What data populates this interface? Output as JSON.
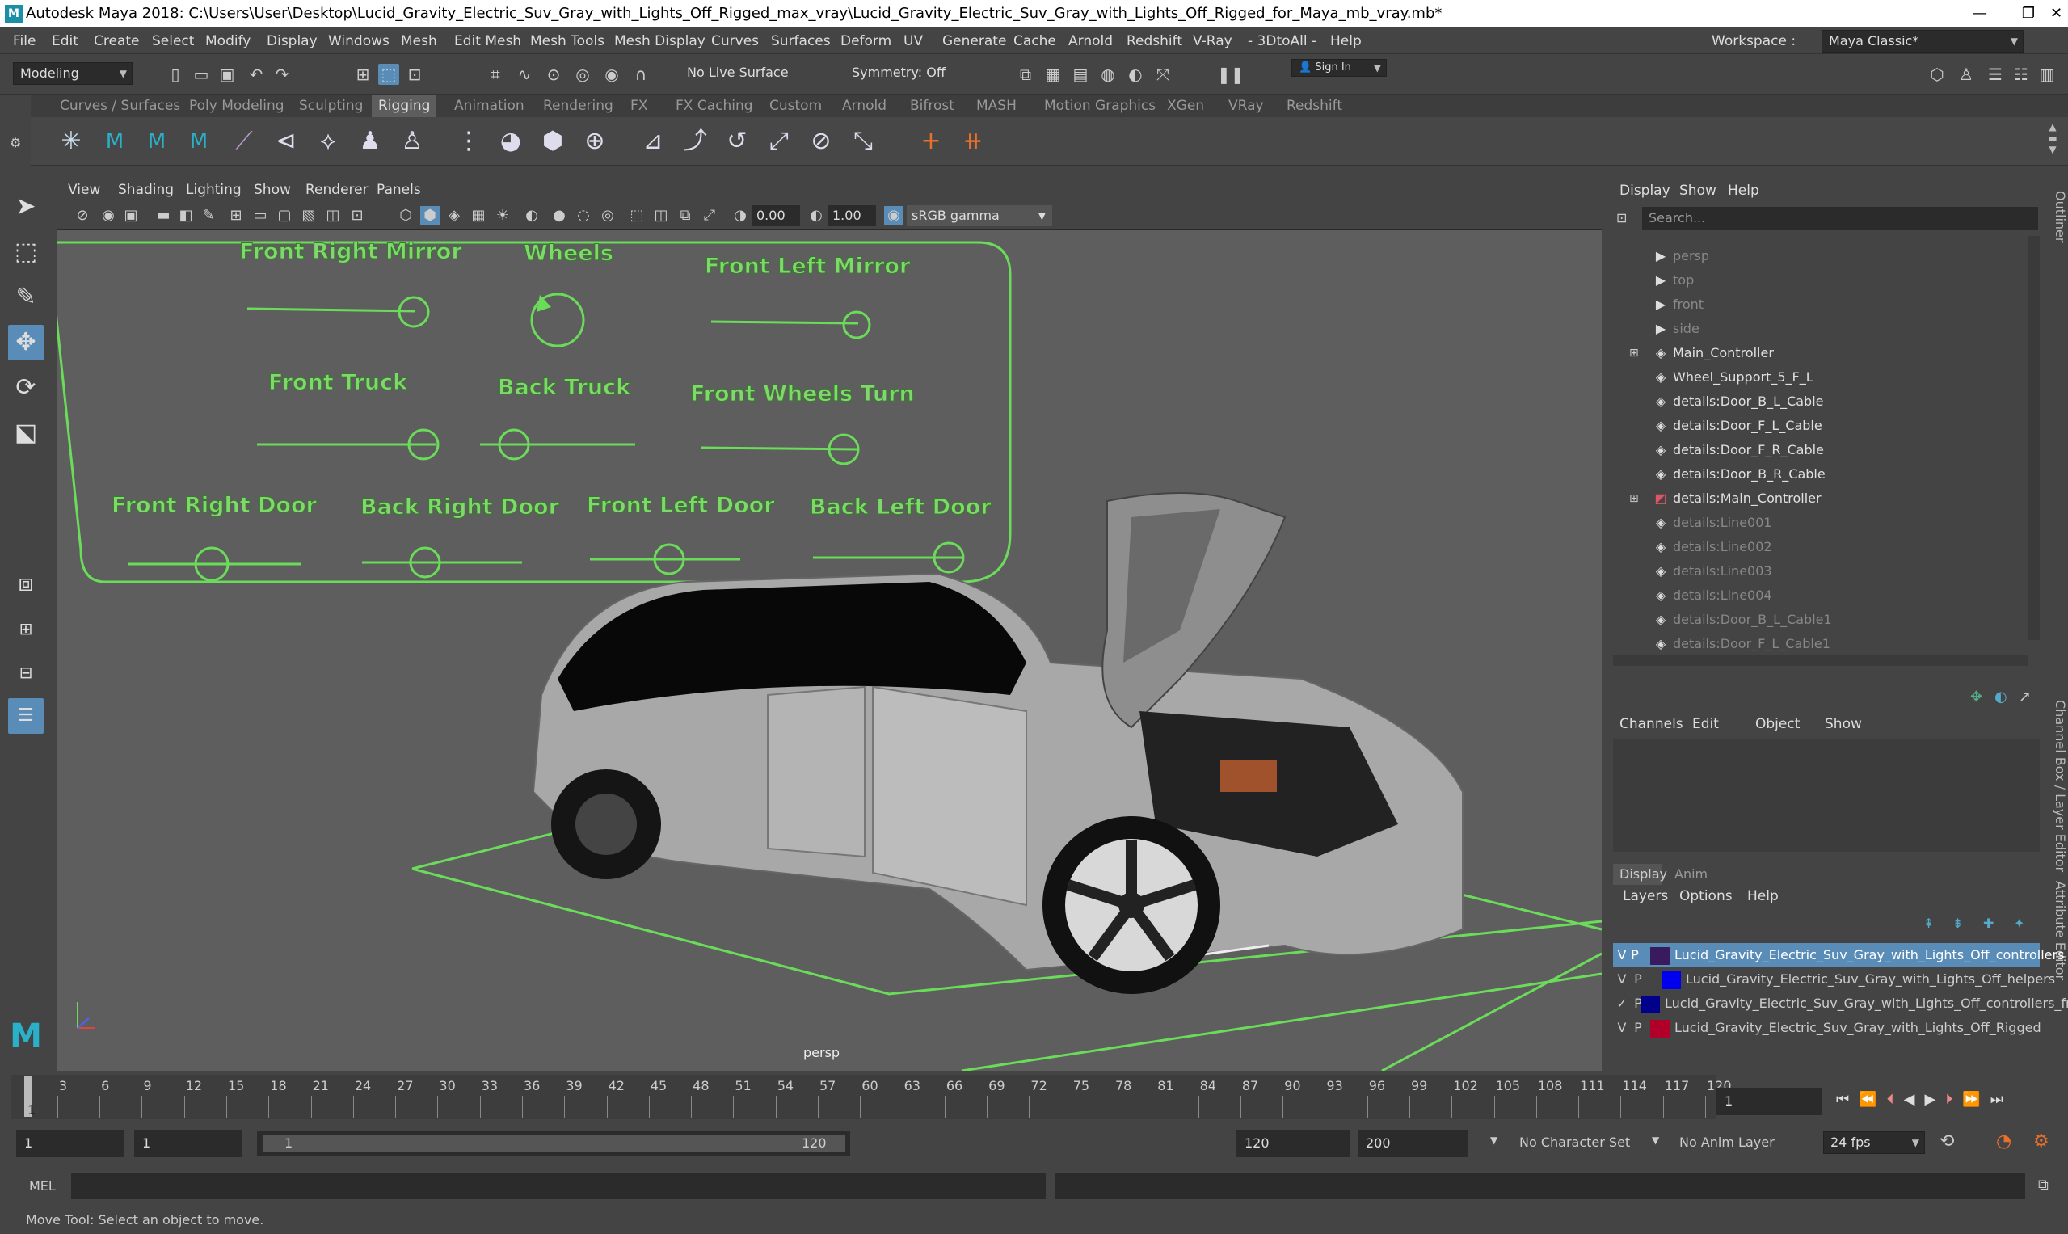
{
  "window": {
    "title": "Autodesk Maya 2018: C:\\Users\\User\\Desktop\\Lucid_Gravity_Electric_Suv_Gray_with_Lights_Off_Rigged_max_vray\\Lucid_Gravity_Electric_Suv_Gray_with_Lights_Off_Rigged_for_Maya_mb_vray.mb*",
    "minimize": "—",
    "maximize": "❐",
    "close": "✕"
  },
  "menu": [
    "File",
    "Edit",
    "Create",
    "Select",
    "Modify",
    "Display",
    "Windows",
    "Mesh",
    "Edit Mesh",
    "Mesh Tools",
    "Mesh Display",
    "Curves",
    "Surfaces",
    "Deform",
    "UV",
    "Generate",
    "Cache",
    "Arnold",
    "Redshift",
    "V-Ray",
    "- 3DtoAll -",
    "Help"
  ],
  "workspace": {
    "label": "Workspace :",
    "value": "Maya Classic*"
  },
  "status": {
    "mode": "Modeling",
    "live_surface": "No Live Surface",
    "symmetry": "Symmetry: Off",
    "sign_in": "Sign In"
  },
  "shelf_tabs": [
    "Curves / Surfaces",
    "Poly Modeling",
    "Sculpting",
    "Rigging",
    "Animation",
    "Rendering",
    "FX",
    "FX Caching",
    "Custom",
    "Arnold",
    "Bifrost",
    "MASH",
    "Motion Graphics",
    "XGen",
    "VRay",
    "Redshift"
  ],
  "shelf_active": "Rigging",
  "viewport": {
    "menu": [
      "View",
      "Shading",
      "Lighting",
      "Show",
      "Renderer",
      "Panels"
    ],
    "exposure": "0.00",
    "gamma": "1.00",
    "color_space": "sRGB gamma",
    "camera_label": "persp"
  },
  "controls": {
    "front_right_mirror": "Front Right Mirror",
    "wheels": "Wheels",
    "front_left_mirror": "Front Left Mirror",
    "front_truck": "Front Truck",
    "back_truck": "Back Truck",
    "front_wheels_turn": "Front Wheels Turn",
    "front_right_door": "Front Right Door",
    "back_right_door": "Back Right Door",
    "front_left_door": "Front Left Door",
    "back_left_door": "Back Left Door"
  },
  "outliner": {
    "menu": [
      "Display",
      "Show",
      "Help"
    ],
    "search_placeholder": "Search...",
    "items": [
      {
        "label": "persp",
        "dim": true,
        "icon": "camera-icon"
      },
      {
        "label": "top",
        "dim": true,
        "icon": "camera-icon"
      },
      {
        "label": "front",
        "dim": true,
        "icon": "camera-icon"
      },
      {
        "label": "side",
        "dim": true,
        "icon": "camera-icon"
      },
      {
        "label": "Main_Controller",
        "dim": false,
        "icon": "transform-icon",
        "expand": true
      },
      {
        "label": "Wheel_Support_5_F_L",
        "dim": false,
        "icon": "transform-icon"
      },
      {
        "label": "details:Door_B_L_Cable",
        "dim": false,
        "icon": "transform-icon"
      },
      {
        "label": "details:Door_F_L_Cable",
        "dim": false,
        "icon": "transform-icon"
      },
      {
        "label": "details:Door_F_R_Cable",
        "dim": false,
        "icon": "transform-icon"
      },
      {
        "label": "details:Door_B_R_Cable",
        "dim": false,
        "icon": "transform-icon"
      },
      {
        "label": "details:Main_Controller",
        "dim": false,
        "icon": "controller-icon",
        "expand": true
      },
      {
        "label": "details:Line001",
        "dim": true,
        "icon": "transform-icon"
      },
      {
        "label": "details:Line002",
        "dim": true,
        "icon": "transform-icon"
      },
      {
        "label": "details:Line003",
        "dim": true,
        "icon": "transform-icon"
      },
      {
        "label": "details:Line004",
        "dim": true,
        "icon": "transform-icon"
      },
      {
        "label": "details:Door_B_L_Cable1",
        "dim": true,
        "icon": "transform-icon"
      },
      {
        "label": "details:Door_F_L_Cable1",
        "dim": true,
        "icon": "transform-icon"
      }
    ]
  },
  "channel_box": {
    "menu": [
      "Channels",
      "Edit",
      "Object",
      "Show"
    ],
    "side_tab": "Channel Box / Layer Editor",
    "attr_tab": "Attribute Editor",
    "outliner_tab": "Outliner"
  },
  "layer_editor": {
    "tabs": [
      "Display",
      "Anim"
    ],
    "menu": [
      "Layers",
      "Options",
      "Help"
    ],
    "layers": [
      {
        "v": "V",
        "p": "P",
        "name": "Lucid_Gravity_Electric_Suv_Gray_with_Lights_Off_controllers",
        "color": "#3a1a5e",
        "selected": true
      },
      {
        "v": "V",
        "p": "P",
        "name": "Lucid_Gravity_Electric_Suv_Gray_with_Lights_Off_helpers",
        "color": "#0000ee",
        "selected": false
      },
      {
        "v": "✓",
        "p": "P",
        "name": "Lucid_Gravity_Electric_Suv_Gray_with_Lights_Off_controllers_fr",
        "color": "#00008a",
        "selected": false
      },
      {
        "v": "V",
        "p": "P",
        "name": "Lucid_Gravity_Electric_Suv_Gray_with_Lights_Off_Rigged",
        "color": "#b0002a",
        "selected": false
      }
    ]
  },
  "timeline": {
    "ticks": [
      "3",
      "6",
      "9",
      "12",
      "15",
      "18",
      "21",
      "24",
      "27",
      "30",
      "33",
      "36",
      "39",
      "42",
      "45",
      "48",
      "51",
      "54",
      "57",
      "60",
      "63",
      "66",
      "69",
      "72",
      "75",
      "78",
      "81",
      "84",
      "87",
      "90",
      "93",
      "96",
      "99",
      "102",
      "105",
      "108",
      "111",
      "114",
      "117",
      "120"
    ],
    "current_frame_marker": "1",
    "current_frame": "1"
  },
  "range": {
    "start": "1",
    "playback_start": "1",
    "slider_start": "1",
    "slider_end": "120",
    "playback_end": "120",
    "end": "200",
    "character_set": "No Character Set",
    "anim_layer": "No Anim Layer",
    "fps": "24 fps"
  },
  "mel": {
    "label": "MEL"
  },
  "help_line": "Move Tool: Select an object to move."
}
